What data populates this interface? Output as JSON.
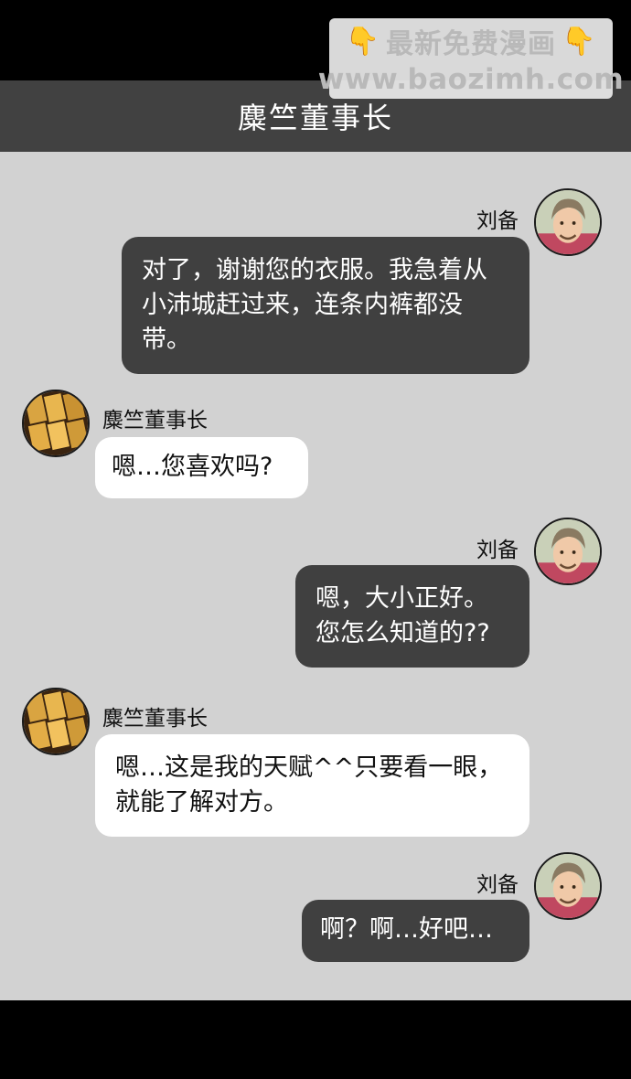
{
  "watermark": {
    "line1": "最新免费漫画",
    "line2": "www.baozimh.com"
  },
  "header": {
    "title": "麋竺董事长"
  },
  "messages": [
    {
      "sender": "刘备",
      "side": "right",
      "text": "对了，谢谢您的衣服。我急着从小沛城赶过来，连条内裤都没带。"
    },
    {
      "sender": "麋竺董事长",
      "side": "left",
      "text": "嗯…您喜欢吗?"
    },
    {
      "sender": "刘备",
      "side": "right",
      "text": "嗯，大小正好。您怎么知道的??"
    },
    {
      "sender": "麋竺董事长",
      "side": "left",
      "text": "嗯…这是我的天赋^^只要看一眼，就能了解对方。"
    },
    {
      "sender": "刘备",
      "side": "right",
      "text": "啊？啊…好吧…"
    }
  ],
  "colors": {
    "header_bg": "#414141",
    "chat_bg": "#d2d2d2",
    "dark_bubble": "#404040",
    "light_bubble": "#ffffff"
  },
  "icons": {
    "watermark_hand": "pointing-down-hand-icon",
    "liu_bei_avatar": "man-portrait-avatar",
    "mi_zhu_avatar": "gold-bars-avatar"
  }
}
